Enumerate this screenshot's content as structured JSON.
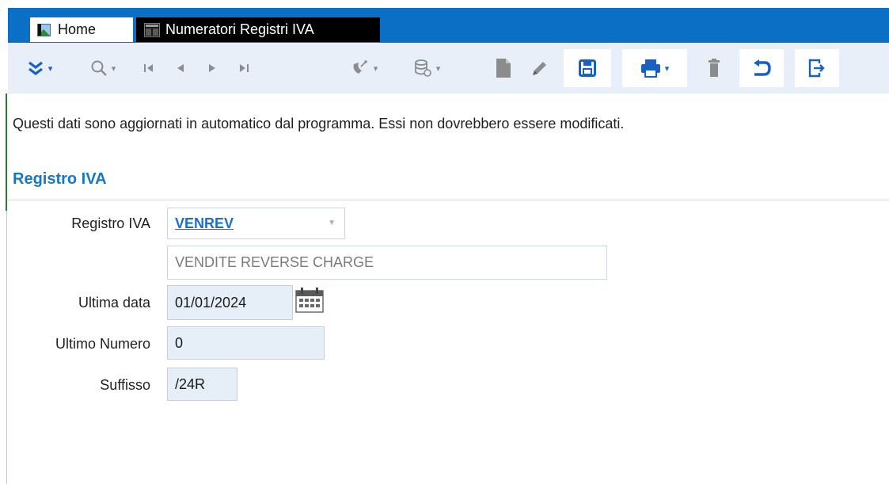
{
  "tabs": {
    "home_label": "Home",
    "active_label": "Numeratori Registri IVA"
  },
  "toolbar": {
    "buttons": [
      "expand-icon",
      "search-icon",
      "first-record-icon",
      "previous-record-icon",
      "next-record-icon",
      "last-record-icon",
      "tools-icon",
      "database-icon",
      "new-document-icon",
      "edit-icon",
      "save-icon",
      "print-icon",
      "delete-icon",
      "undo-icon",
      "exit-icon"
    ]
  },
  "info_text": "Questi dati sono aggiornati in automatico dal programma. Essi non dovrebbero essere modificati.",
  "section": {
    "title": "Registro IVA"
  },
  "form": {
    "registro_label": "Registro IVA",
    "registro_value": "VENREV",
    "registro_description": "VENDITE REVERSE CHARGE",
    "ultima_data_label": "Ultima data",
    "ultima_data_value": "01/01/2024",
    "ultimo_numero_label": "Ultimo Numero",
    "ultimo_numero_value": "0",
    "suffisso_label": "Suffisso",
    "suffisso_value": "/24R"
  },
  "colors": {
    "tab_bar": "#0b6fc6",
    "toolbar_bg": "#e8eff8",
    "accent_blue": "#1760c4",
    "section_title": "#1777c6",
    "link": "#1a6fd0",
    "field_blue": "#e6eef8"
  }
}
